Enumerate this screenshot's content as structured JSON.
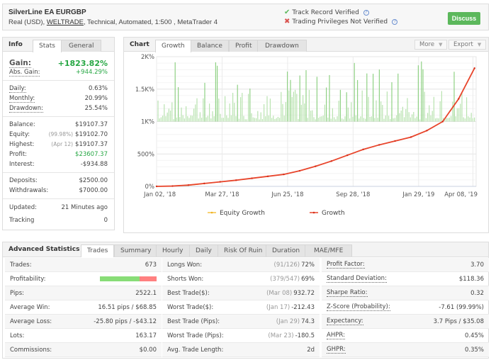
{
  "header": {
    "title": "SilverLine EA EURGBP",
    "sub_prefix": "Real (USD), ",
    "broker": "WELTRADE",
    "sub_suffix": ", Technical, Automated, 1:500 , MetaTrader 4",
    "track_record": "Track Record Verified",
    "trading_privileges": "Trading Privileges Not Verified",
    "discuss": "Discuss"
  },
  "info": {
    "tabs": [
      "Info",
      "Stats",
      "General"
    ],
    "gain_label": "Gain:",
    "gain": "+1823.82%",
    "abs_gain_label": "Abs. Gain:",
    "abs_gain": "+944.29%",
    "daily_label": "Daily:",
    "daily": "0.63%",
    "monthly_label": "Monthly:",
    "monthly": "20.99%",
    "drawdown_label": "Drawdown:",
    "drawdown": "25.54%",
    "balance_label": "Balance:",
    "balance": "$19107.37",
    "equity_label": "Equity:",
    "equity_pct": "(99.98%)",
    "equity": "$19102.70",
    "highest_label": "Highest:",
    "highest_date": "(Apr 12)",
    "highest": "$19107.37",
    "profit_label": "Profit:",
    "profit": "$23607.37",
    "interest_label": "Interest:",
    "interest": "-$934.88",
    "deposits_label": "Deposits:",
    "deposits": "$2500.00",
    "withdrawals_label": "Withdrawals:",
    "withdrawals": "$7000.00",
    "updated_label": "Updated:",
    "updated": "21 Minutes ago",
    "tracking_label": "Tracking",
    "tracking": "0"
  },
  "chart_panel": {
    "title": "Chart",
    "tabs": [
      "Growth",
      "Balance",
      "Profit",
      "Drawdown"
    ],
    "more": "More",
    "export": "Export"
  },
  "chart_data": {
    "type": "line",
    "title": "Growth",
    "xlabel": "",
    "ylabel": "",
    "ylim": [
      0,
      2000
    ],
    "y_ticks": [
      "0%",
      "500%",
      "1K%",
      "1.5K%",
      "2K%"
    ],
    "y_tick_values": [
      0,
      500,
      1000,
      1500,
      2000
    ],
    "x_ticks": [
      "Jan 02, '18",
      "Mar 27, '18",
      "Jun 25, '18",
      "Sep 28, '18",
      "Jan 29, '19",
      "Apr 08, '19"
    ],
    "grid": true,
    "legend": [
      "Equity Growth",
      "Growth"
    ],
    "legend_position": "bottom",
    "series": [
      {
        "name": "Growth",
        "color": "#e8452c",
        "x": [
          0,
          0.05,
          0.1,
          0.15,
          0.2,
          0.25,
          0.3,
          0.35,
          0.4,
          0.45,
          0.5,
          0.55,
          0.6,
          0.65,
          0.7,
          0.75,
          0.8,
          0.85,
          0.9,
          0.95,
          1.0
        ],
        "values": [
          0,
          5,
          20,
          45,
          70,
          95,
          125,
          155,
          185,
          240,
          310,
          390,
          480,
          570,
          640,
          700,
          760,
          860,
          1000,
          1350,
          1823
        ]
      },
      {
        "name": "Equity Growth",
        "color": "#f5c342",
        "x": [
          0,
          0.05,
          0.1,
          0.15,
          0.2,
          0.25,
          0.3,
          0.35,
          0.4,
          0.45,
          0.5,
          0.55,
          0.6,
          0.65,
          0.7,
          0.75,
          0.8,
          0.85,
          0.9,
          0.95,
          1.0
        ],
        "values": [
          0,
          5,
          15,
          42,
          70,
          95,
          125,
          155,
          185,
          240,
          310,
          390,
          480,
          570,
          640,
          700,
          760,
          860,
          1000,
          1350,
          1823
        ]
      }
    ],
    "bars_note": "Per-trade bars (green) plotted above 1K% baseline, heights 0-850 relative"
  },
  "advanced": {
    "title": "Advanced Statistics",
    "tabs": [
      "Trades",
      "Summary",
      "Hourly",
      "Daily",
      "Risk Of Ruin",
      "Duration",
      "MAE/MFE"
    ],
    "col1": [
      {
        "label": "Trades:",
        "value": "673"
      },
      {
        "label": "Profitability:",
        "value": "",
        "win_fraction": 0.7
      },
      {
        "label": "Pips:",
        "value": "2522.1"
      },
      {
        "label": "Average Win:",
        "value": "16.51 pips / $68.85"
      },
      {
        "label": "Average Loss:",
        "value": "-25.80 pips / -$43.12"
      },
      {
        "label": "Lots:",
        "value": "163.17"
      },
      {
        "label": "Commissions:",
        "value": "$0.00"
      }
    ],
    "col2": [
      {
        "label": "Longs Won:",
        "muted": "(91/126)",
        "value": "72%"
      },
      {
        "label": "Shorts Won:",
        "muted": "(379/547)",
        "value": "69%"
      },
      {
        "label": "Best Trade($):",
        "muted": "(Mar 08)",
        "value": "932.72"
      },
      {
        "label": "Worst Trade($):",
        "muted": "(Jan 17)",
        "value": "-212.43"
      },
      {
        "label": "Best Trade (Pips):",
        "muted": "(Jan 29)",
        "value": "74.3"
      },
      {
        "label": "Worst Trade (Pips):",
        "muted": "(Mar 23)",
        "value": "-180.5"
      },
      {
        "label": "Avg. Trade Length:",
        "muted": "",
        "value": "2d"
      }
    ],
    "col3": [
      {
        "label": "Profit Factor:",
        "value": "3.70"
      },
      {
        "label": "Standard Deviation:",
        "value": "$118.36"
      },
      {
        "label": "Sharpe Ratio:",
        "value": "0.32"
      },
      {
        "label": "Z-Score (Probability):",
        "value": "-7.61 (99.99%)"
      },
      {
        "label": "Expectancy:",
        "value": "3.7 Pips / $35.08"
      },
      {
        "label": "AHPR:",
        "value": "0.45%"
      },
      {
        "label": "GHPR:",
        "value": "0.35%"
      }
    ]
  }
}
